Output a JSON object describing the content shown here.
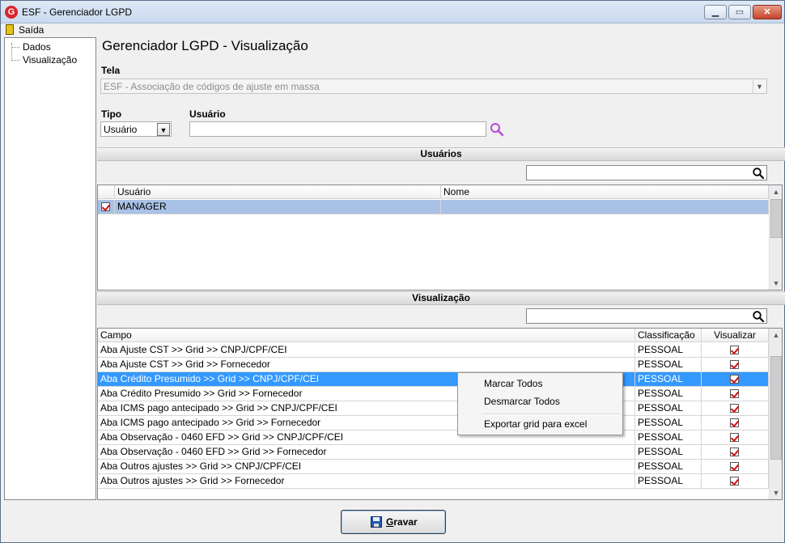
{
  "window": {
    "title": "ESF - Gerenciador LGPD",
    "app_icon_letter": "G",
    "min_glyph": "▁",
    "max_glyph": "▭",
    "close_glyph": "✕"
  },
  "menu": {
    "exit_label": "Saída"
  },
  "tree": {
    "items": [
      "Dados",
      "Visualização"
    ]
  },
  "page": {
    "title": "Gerenciador LGPD - Visualização"
  },
  "tela": {
    "label": "Tela",
    "value": "ESF - Associação de códigos de ajuste em massa"
  },
  "tipo": {
    "label": "Tipo",
    "value": "Usuário"
  },
  "usuario": {
    "label": "Usuário",
    "value": ""
  },
  "usuarios_section": {
    "title": "Usuários",
    "search_value": "",
    "columns": [
      "Usuário",
      "Nome"
    ],
    "rows": [
      {
        "usuario": "MANAGER",
        "nome": "",
        "checked": true
      }
    ]
  },
  "visualizacao_section": {
    "title": "Visualização",
    "search_value": "",
    "columns": [
      "Campo",
      "Classificação",
      "Visualizar"
    ],
    "rows": [
      {
        "campo": "Aba Ajuste CST >> Grid >> CNPJ/CPF/CEI",
        "classificacao": "PESSOAL",
        "visualizar": true
      },
      {
        "campo": "Aba Ajuste CST >> Grid >> Fornecedor",
        "classificacao": "PESSOAL",
        "visualizar": true
      },
      {
        "campo": "Aba Crédito Presumido >> Grid >> CNPJ/CPF/CEI",
        "classificacao": "PESSOAL",
        "visualizar": true,
        "selected": true
      },
      {
        "campo": "Aba Crédito Presumido >> Grid >> Fornecedor",
        "classificacao": "PESSOAL",
        "visualizar": true
      },
      {
        "campo": "Aba ICMS pago antecipado >> Grid >> CNPJ/CPF/CEI",
        "classificacao": "PESSOAL",
        "visualizar": true
      },
      {
        "campo": "Aba ICMS pago antecipado >> Grid >> Fornecedor",
        "classificacao": "PESSOAL",
        "visualizar": true
      },
      {
        "campo": "Aba Observação - 0460 EFD >> Grid >> CNPJ/CPF/CEI",
        "classificacao": "PESSOAL",
        "visualizar": true
      },
      {
        "campo": "Aba Observação - 0460 EFD >> Grid >> Fornecedor",
        "classificacao": "PESSOAL",
        "visualizar": true
      },
      {
        "campo": "Aba Outros ajustes >> Grid >> CNPJ/CPF/CEI",
        "classificacao": "PESSOAL",
        "visualizar": true
      },
      {
        "campo": "Aba Outros ajustes >> Grid >> Fornecedor",
        "classificacao": "PESSOAL",
        "visualizar": true
      }
    ]
  },
  "context_menu": {
    "items": [
      "Marcar Todos",
      "Desmarcar Todos",
      "Exportar grid para excel"
    ]
  },
  "footer": {
    "save_label_underlined": "G",
    "save_label_rest": "ravar"
  },
  "colors": {
    "selection": "#3399ff",
    "accent_check": "#d10f0f",
    "lookup_icon": "#b44ad6"
  }
}
